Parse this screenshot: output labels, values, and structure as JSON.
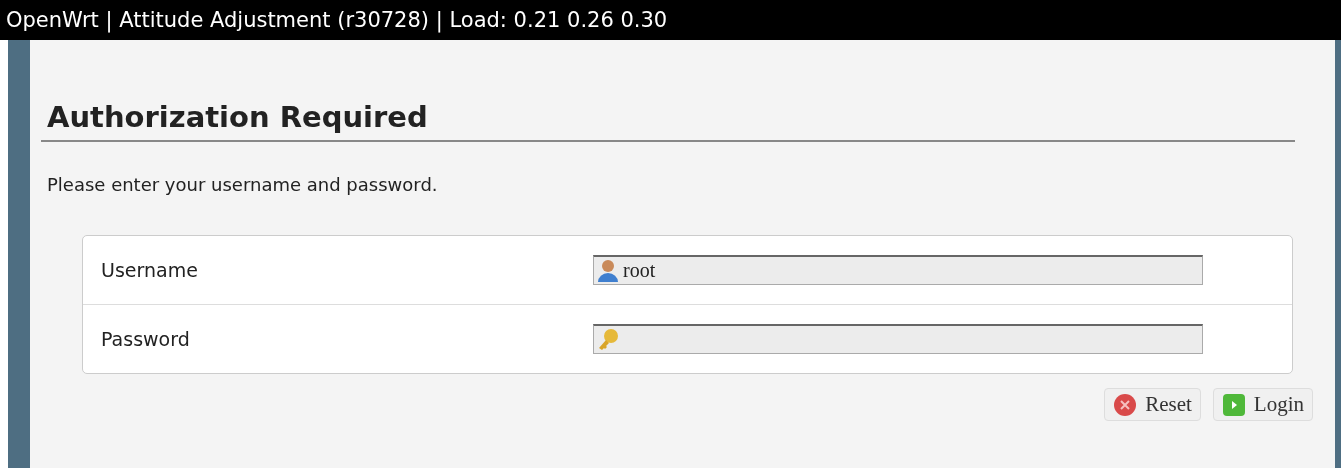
{
  "header": {
    "title": "OpenWrt | Attitude Adjustment (r30728) | Load: 0.21 0.26 0.30"
  },
  "heading": "Authorization Required",
  "intro": "Please enter your username and password.",
  "fields": [
    {
      "label": "Username",
      "kind": "user",
      "value": "root"
    },
    {
      "label": "Password",
      "kind": "password"
    }
  ],
  "buttons": [
    {
      "label": "Reset",
      "kind": "reset"
    },
    {
      "label": "Login",
      "kind": "login"
    }
  ]
}
